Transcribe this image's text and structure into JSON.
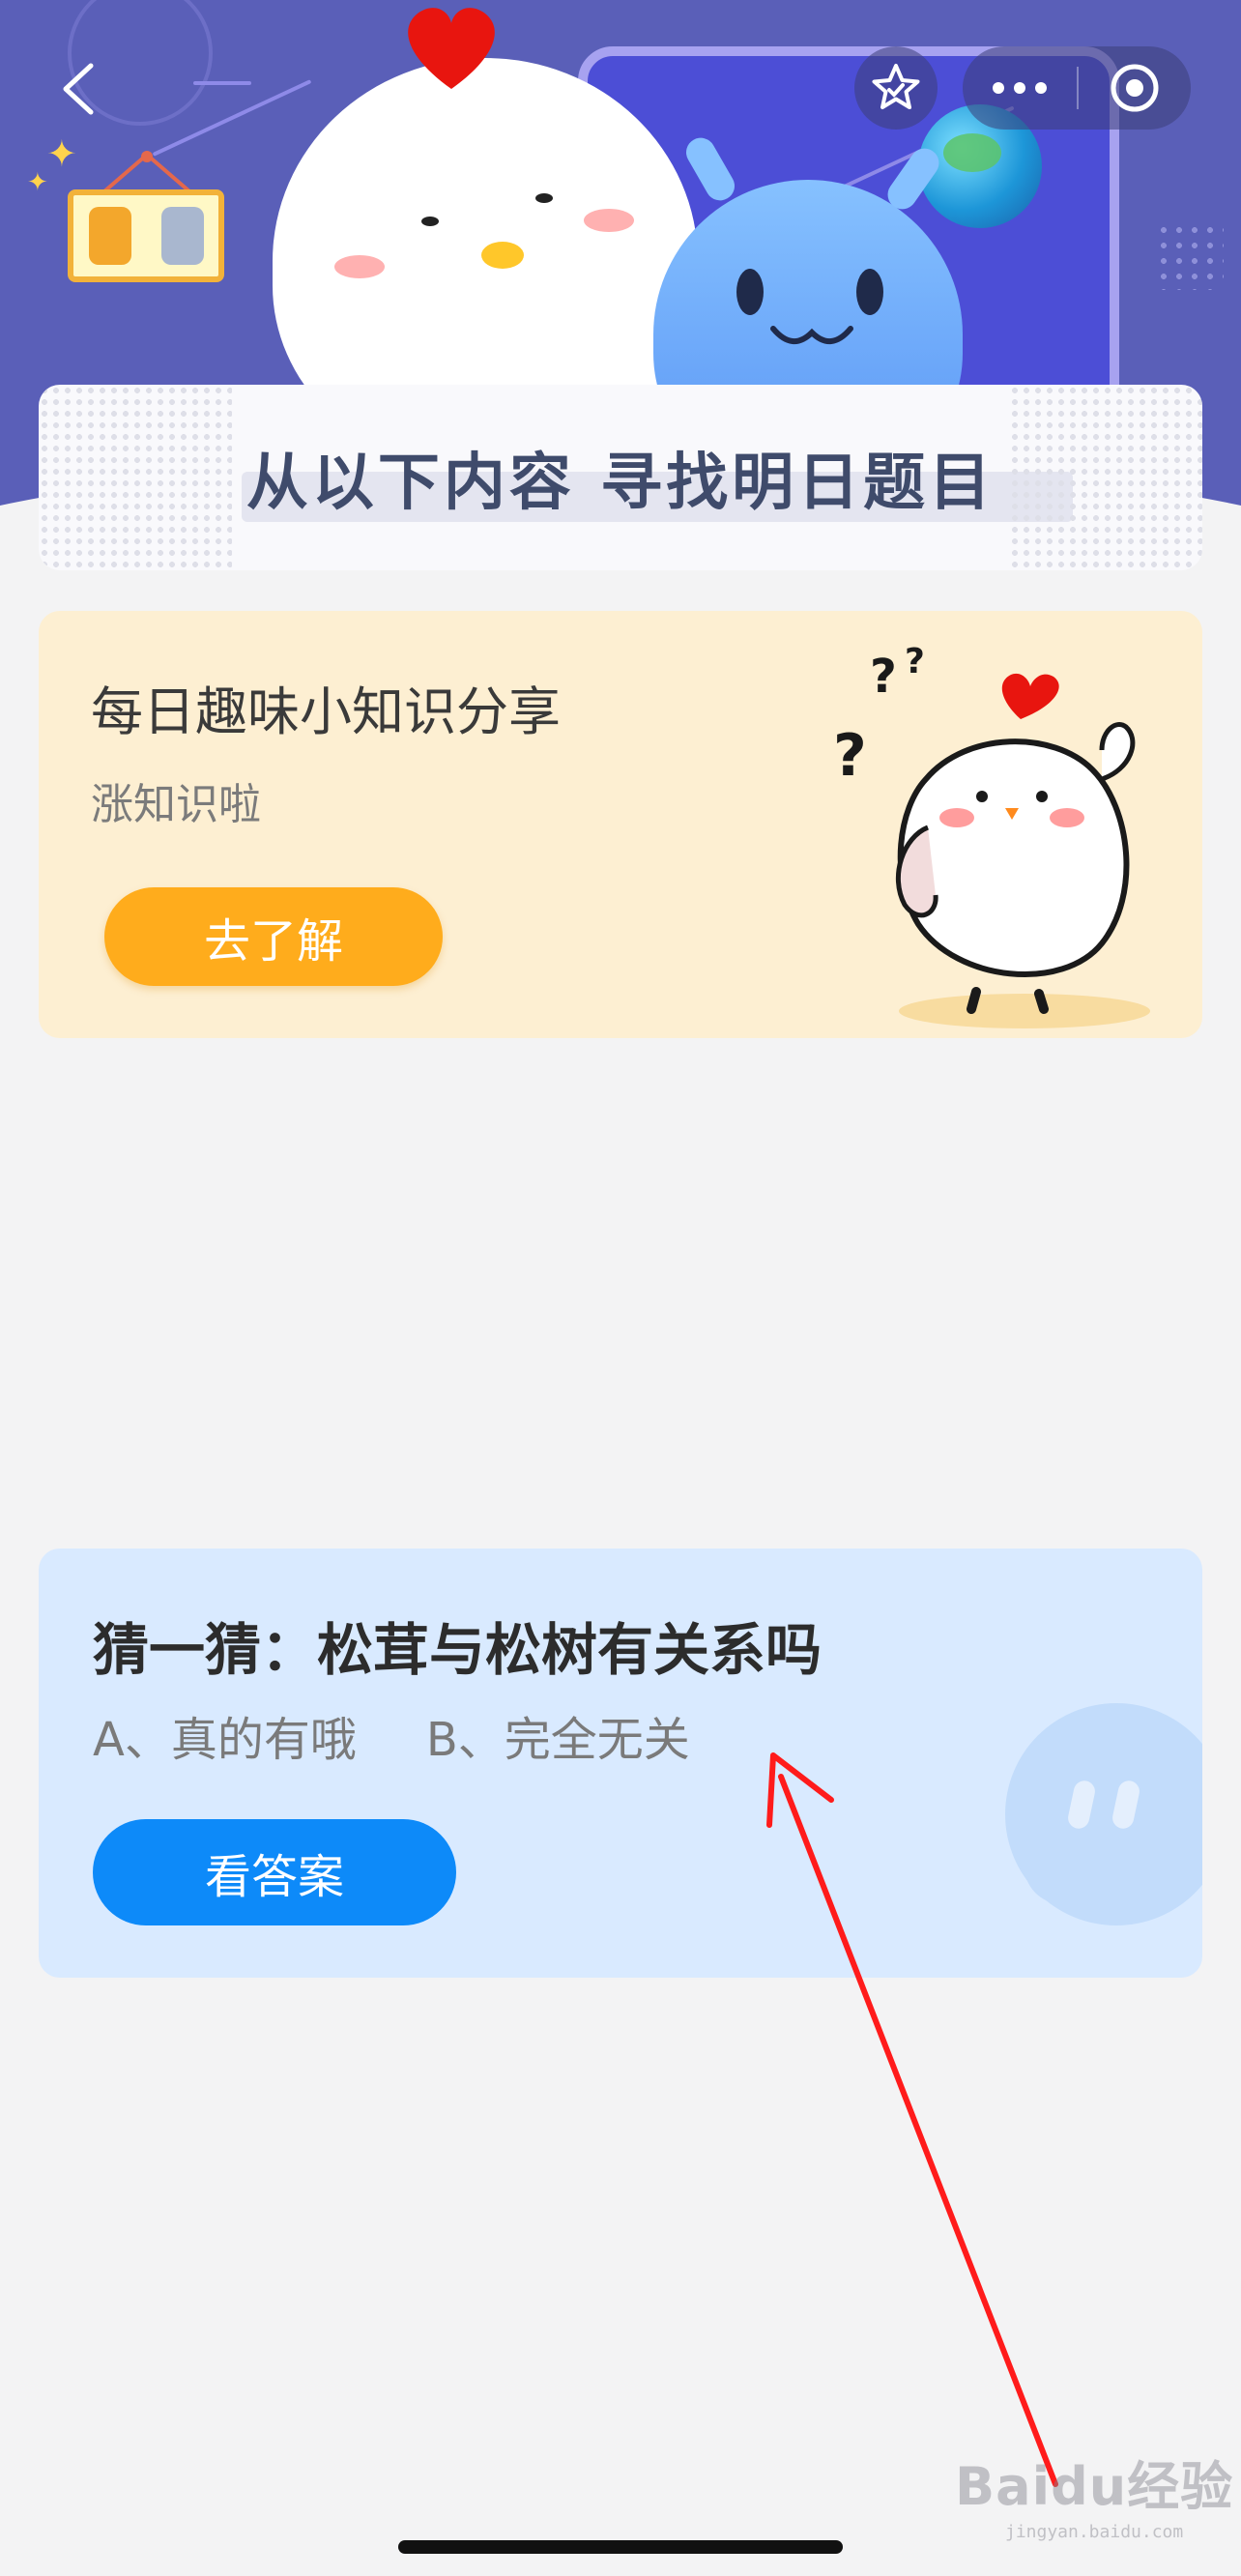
{
  "header": {
    "icons": [
      "back-icon",
      "star-icon",
      "more-icon",
      "target-icon"
    ],
    "banner_title": "从以下内容 寻找明日题目"
  },
  "knowledge_card": {
    "title": "每日趣味小知识分享",
    "subtitle": "涨知识啦",
    "button_label": "去了解",
    "accent_color": "#ffac1c",
    "background_color": "#fdefd2"
  },
  "guess_card": {
    "title": "猜一猜：松茸与松树有关系吗",
    "option_a": "A、真的有哦",
    "option_b": "B、完全无关",
    "button_label": "看答案",
    "accent_color": "#0d8af9",
    "background_color": "#d9eaff"
  },
  "watermark": {
    "main": "Baidu经验",
    "url": "jingyan.baidu.com"
  },
  "annotation": {
    "color": "#ff1b1b"
  }
}
